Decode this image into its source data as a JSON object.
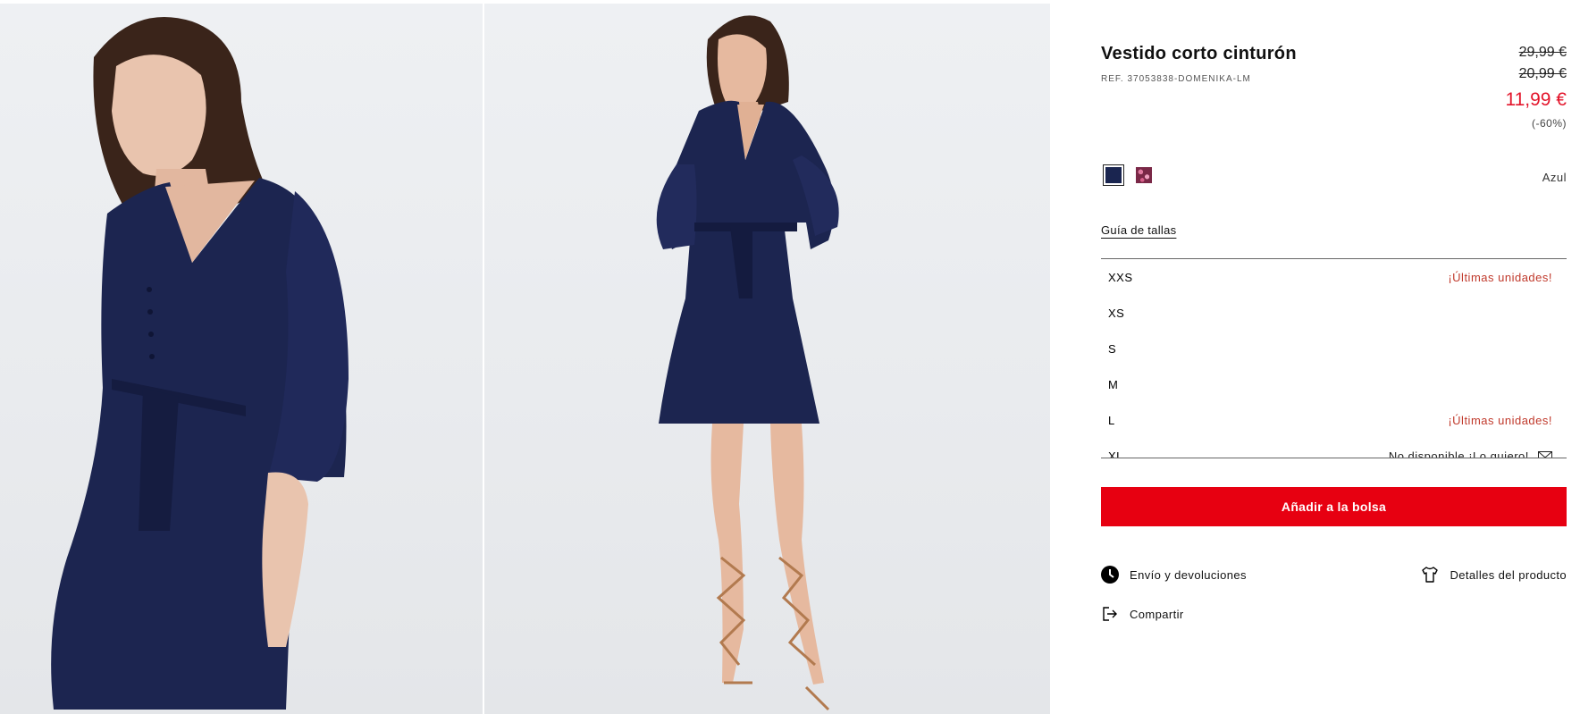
{
  "gallery": {
    "images": [
      {
        "alt": "model-closeup",
        "colors": {
          "dress": "#1c2550",
          "skin": "#e9c4ae",
          "hair": "#3a241a"
        }
      },
      {
        "alt": "model-fullbody",
        "colors": {
          "dress": "#1c2550",
          "skin": "#e6b99f",
          "hair": "#3a241a",
          "sandal": "#b27a4f"
        }
      }
    ]
  },
  "product": {
    "title": "Vestido corto cinturón",
    "ref": "REF. 37053838-DOMENIKA-LM",
    "prices": {
      "original": "29,99 €",
      "previous": "20,99 €",
      "current": "11,99 €",
      "discount": "(-60%)"
    },
    "colors": {
      "swatches": [
        {
          "name": "navy",
          "hex": "#1a2550",
          "selected": true
        },
        {
          "name": "pink-floral",
          "hex": "#9c3a5e",
          "selected": false
        }
      ],
      "selected_label": "Azul"
    },
    "size_guide": "Guía de tallas",
    "sizes": [
      {
        "label": "XXS",
        "note": "¡Últimas unidades!"
      },
      {
        "label": "XS",
        "note": ""
      },
      {
        "label": "S",
        "note": ""
      },
      {
        "label": "M",
        "note": ""
      },
      {
        "label": "L",
        "note": "¡Últimas unidades!"
      },
      {
        "label": "XL",
        "note": "No disponible ¡Lo quiero!",
        "icon": "mail-icon"
      }
    ],
    "add_to_bag": "Añadir a la bolsa",
    "links": {
      "shipping": "Envío y devoluciones",
      "details": "Detalles del producto",
      "share": "Compartir"
    }
  },
  "theme": {
    "accent": "#e70011",
    "sale_price": "#e3152b",
    "low_stock": "#c0392b"
  }
}
